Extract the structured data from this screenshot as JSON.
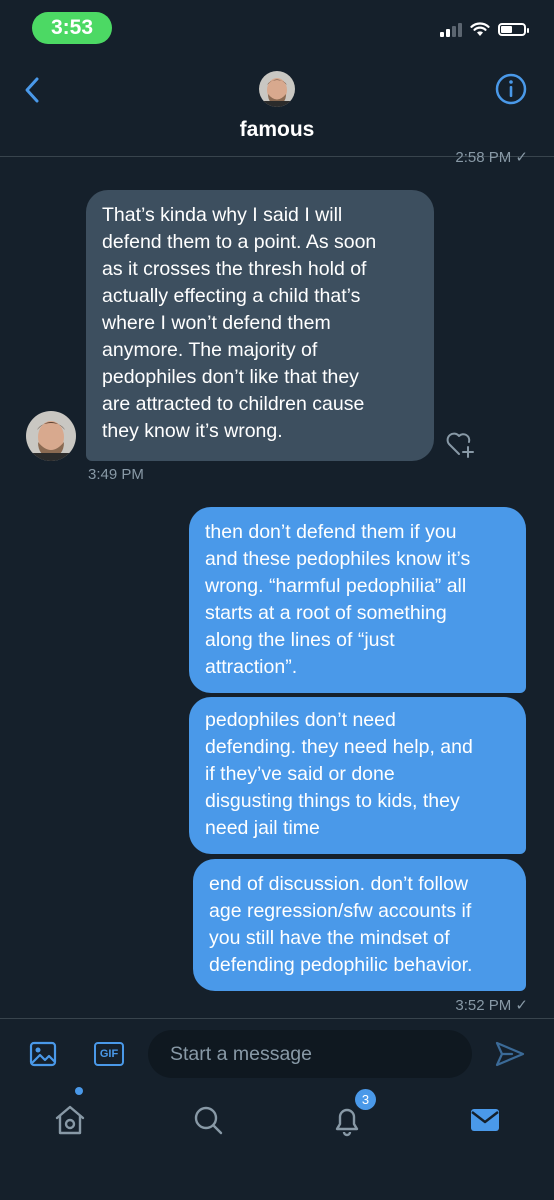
{
  "status_bar": {
    "time": "3:53"
  },
  "header": {
    "name": "famous"
  },
  "thread": {
    "clipped_timestamp": "2:58 PM ✓",
    "incoming": {
      "text": "That’s kinda why I said I will\ndefend them to a point. As soon\nas it crosses the thresh hold of\nactually effecting a child that’s\nwhere I won’t defend them\nanymore. The majority of\npedophiles don’t like that they\nare attracted to children cause\nthey know it’s wrong.",
      "time": "3:49 PM"
    },
    "outgoing": [
      {
        "text": "then don’t defend them if you\nand these pedophiles know it’s\nwrong. “harmful pedophilia” all\nstarts at a root of something\nalong the lines of “just\nattraction”."
      },
      {
        "text": "pedophiles don’t need\ndefending. they need help, and\nif they’ve said or done\ndisgusting things to kids, they\nneed jail time"
      },
      {
        "text": "end of discussion. don’t follow\nage regression/sfw accounts if\nyou still have the mindset of\ndefending pedophilic behavior."
      }
    ],
    "outgoing_time": "3:52 PM ✓"
  },
  "composer": {
    "gif_label": "GIF",
    "placeholder": "Start a message"
  },
  "tabbar": {
    "notifications_badge": "3"
  },
  "colors": {
    "background": "#15202b",
    "incoming_bubble": "#3d4f5f",
    "outgoing_bubble": "#4a99e9",
    "accent": "#4a99e9",
    "time_pill": "#4cd964"
  },
  "icons": [
    "chevron-left-icon",
    "info-icon",
    "heart-plus-icon",
    "image-icon",
    "gif-icon",
    "send-icon",
    "home-icon",
    "search-icon",
    "bell-icon",
    "mail-icon"
  ]
}
